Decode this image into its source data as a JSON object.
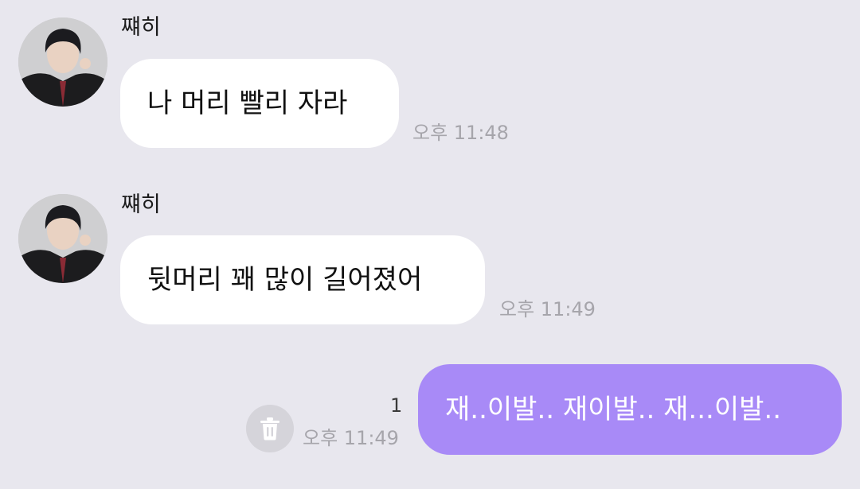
{
  "messages": [
    {
      "sender": "쨰히",
      "text": "나 머리 빨리 자라",
      "time": "오후 11:48"
    },
    {
      "sender": "쨰히",
      "text": "뒷머리 꽤 많이 길어졌어",
      "time": "오후 11:49"
    },
    {
      "text": "재..이발.. 재이발.. 재...이발..",
      "time": "오후 11:49",
      "unread_count": "1"
    }
  ],
  "colors": {
    "background": "#e8e7ee",
    "incoming_bubble": "#ffffff",
    "outgoing_bubble": "#a88af7",
    "timestamp": "#a6a5ab"
  },
  "icons": {
    "delete": "trash-icon"
  }
}
